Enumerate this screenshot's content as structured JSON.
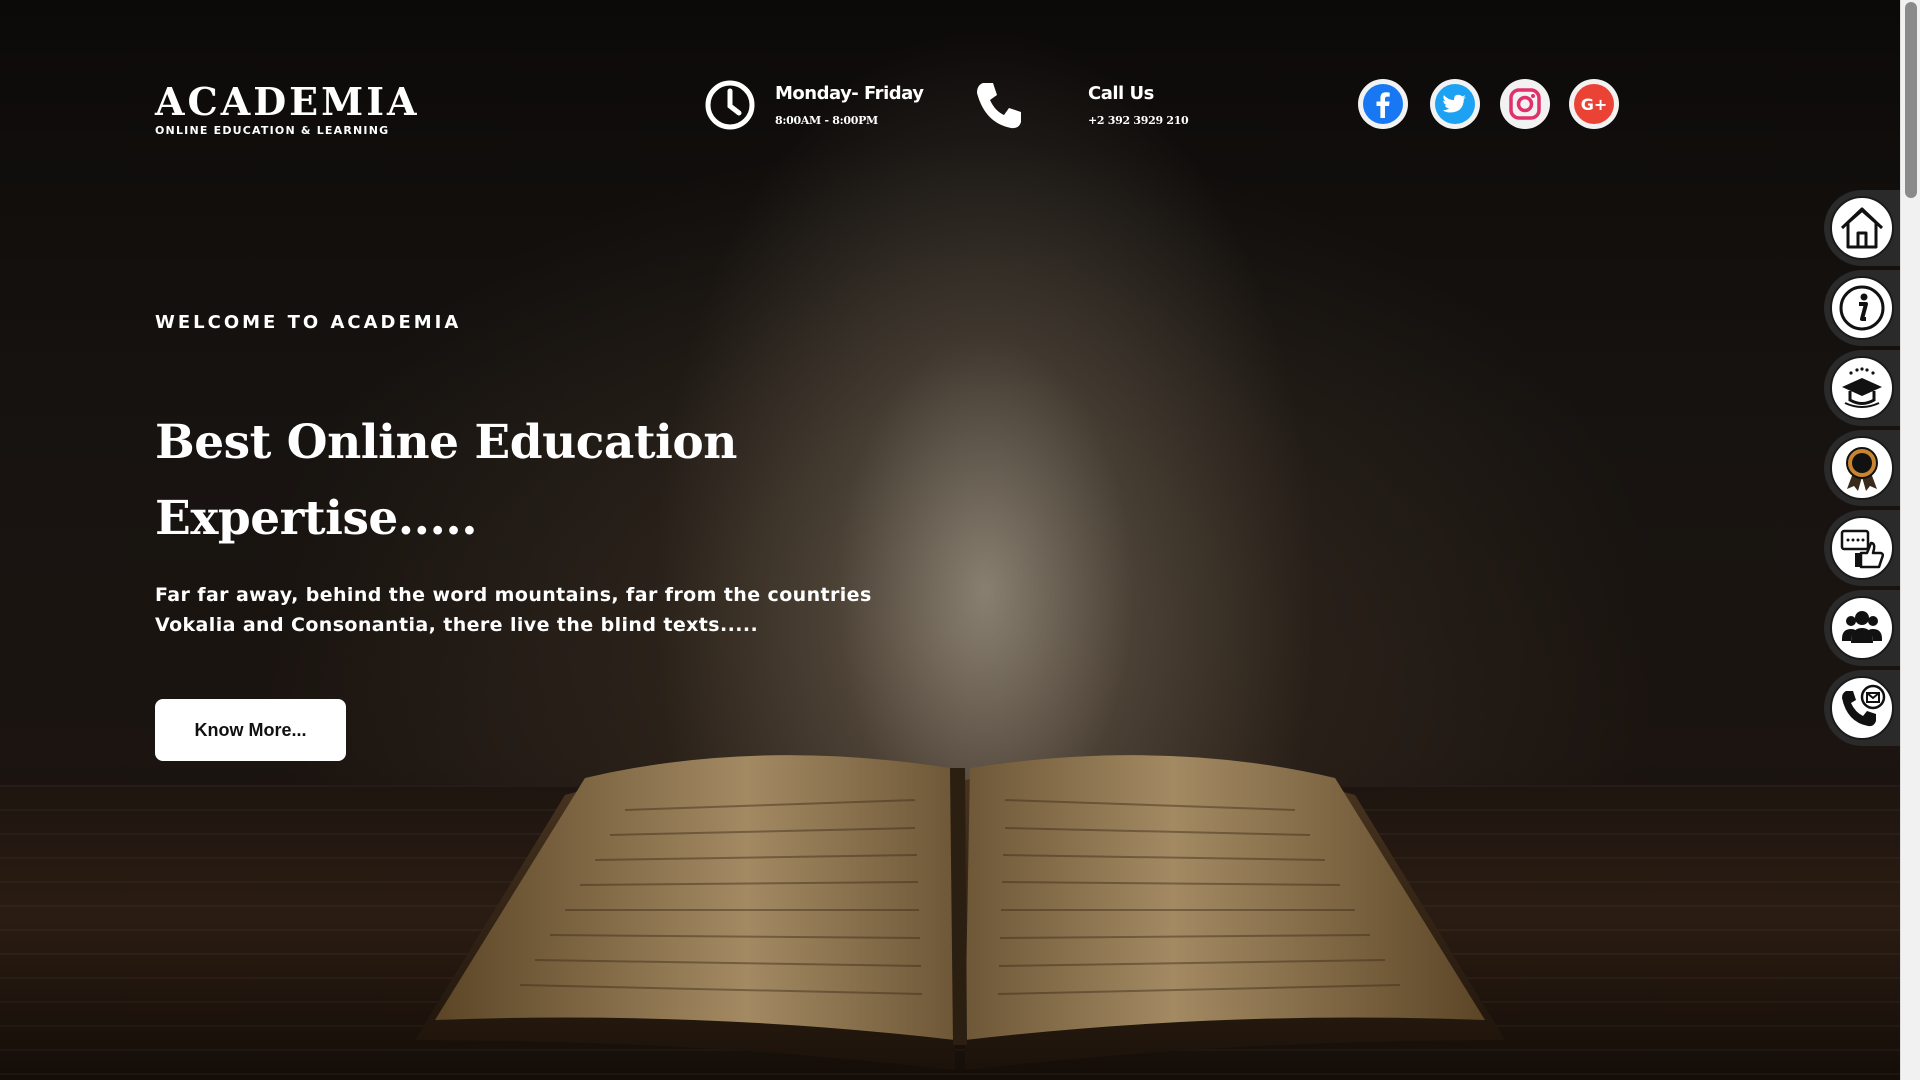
{
  "header": {
    "logo_title": "ACADEMIA",
    "logo_subtitle": "ONLINE EDUCATION & LEARNING",
    "hours_title": "Monday- Friday",
    "hours_value": "8:00AM - 8:00PM",
    "call_title": "Call Us",
    "call_value": "+2 392 3929 210",
    "social": [
      {
        "icon": "facebook-icon",
        "color": "#1877f2"
      },
      {
        "icon": "twitter-icon",
        "color": "#1da1f2"
      },
      {
        "icon": "instagram-icon",
        "color": "#e1306c"
      },
      {
        "icon": "google-plus-icon",
        "color": "#ea4335"
      }
    ]
  },
  "hero": {
    "welcome": "WELCOME TO ACADEMIA",
    "headline_line1": "Best Online Education",
    "headline_line2": "Expertise.....",
    "description": "Far far away, behind the word mountains, far from the countries Vokalia and Consonantia, there live the blind texts.....",
    "cta_label": "Know More..."
  },
  "side_nav": [
    {
      "icon": "home-icon"
    },
    {
      "icon": "info-icon"
    },
    {
      "icon": "graduation-cap-icon"
    },
    {
      "icon": "award-ribbon-icon"
    },
    {
      "icon": "testimonial-thumbs-up-icon"
    },
    {
      "icon": "team-icon"
    },
    {
      "icon": "contact-phone-mail-icon"
    }
  ]
}
